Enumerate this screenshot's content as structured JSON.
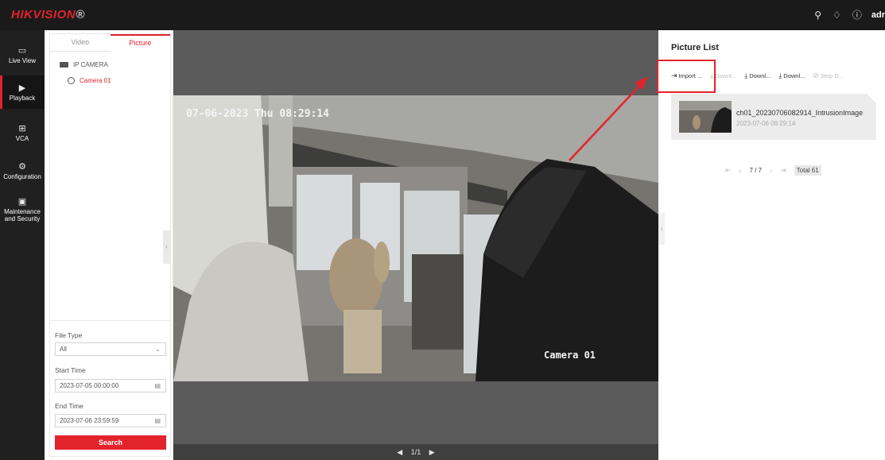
{
  "header": {
    "brand_red": "HIKVISION",
    "brand_mark": "®",
    "user": "adr"
  },
  "nav": {
    "items": [
      {
        "label": "Live View",
        "icon": "monitor-icon"
      },
      {
        "label": "Playback",
        "icon": "playback-icon"
      },
      {
        "label": "VCA",
        "icon": "vca-icon"
      },
      {
        "label": "Configuration",
        "icon": "gear-icon"
      },
      {
        "label": "Maintenance and Security",
        "icon": "maintenance-icon"
      }
    ],
    "active": "Playback"
  },
  "left_panel": {
    "tabs": [
      "Video",
      "Picture"
    ],
    "active_tab": "Picture",
    "tree_root": "IP CAMERA",
    "tree_child": "Camera 01",
    "file_type_label": "File Type",
    "file_type_value": "All",
    "start_time_label": "Start Time",
    "start_time_value": "2023-07-05 00:00:00",
    "end_time_label": "End Time",
    "end_time_value": "2023-07-06 23:59:59",
    "search_label": "Search"
  },
  "video": {
    "osd_time": "07-06-2023 Thu 08:29:14",
    "osd_camera": "Camera 01",
    "page_indicator": "1/1"
  },
  "picture_list": {
    "title": "Picture List",
    "toolbar": [
      "Import ...",
      "Downl...",
      "Downl...",
      "Downl...",
      "Stop D..."
    ],
    "item": {
      "name": "ch01_20230706082914_IntrusionImage",
      "time": "2023-07-06 08:29:14"
    },
    "pager": {
      "current": "7 / 7",
      "total": "Total 61"
    }
  },
  "colors": {
    "accent": "#e3232c",
    "topbar": "#1a1a1a",
    "nav_bg": "#202020",
    "video_bg": "#5b5b5b"
  }
}
